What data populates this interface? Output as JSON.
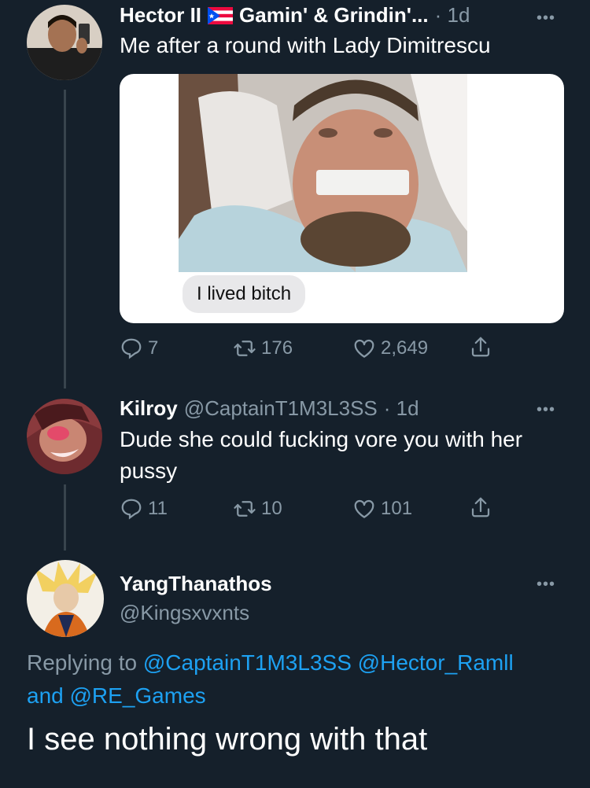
{
  "tweet1": {
    "author": "Hector II",
    "flag": "🇵🇷",
    "display_suffix": "Gamin' & Grindin'...",
    "time": "· 1d",
    "text": "Me after a round with Lady Dimitrescu",
    "media_bubble_text": "I lived bitch",
    "reply_count": "7",
    "retweet_count": "176",
    "like_count": "2,649"
  },
  "tweet2": {
    "author": "Kilroy",
    "handle": "@CaptainT1M3L3SS",
    "time": "· 1d",
    "text": "Dude she could fucking vore you with her pussy",
    "reply_count": "11",
    "retweet_count": "10",
    "like_count": "101"
  },
  "tweet3": {
    "author": "YangThanathos",
    "handle": "@Kingsxvxnts",
    "replying_prefix": "Replying to",
    "mention1": "@CaptainT1M3L3SS",
    "mention2": "@Hector_Ramll",
    "and_word": "and",
    "mention3": "@RE_Games",
    "text": "I see nothing wrong with that"
  },
  "icons": [
    "reply-icon",
    "retweet-icon",
    "like-icon",
    "share-icon",
    "more-icon"
  ],
  "colors": {
    "background": "#15202b",
    "muted": "#8899a6",
    "link": "#1da1f2",
    "divider": "#38444d"
  }
}
